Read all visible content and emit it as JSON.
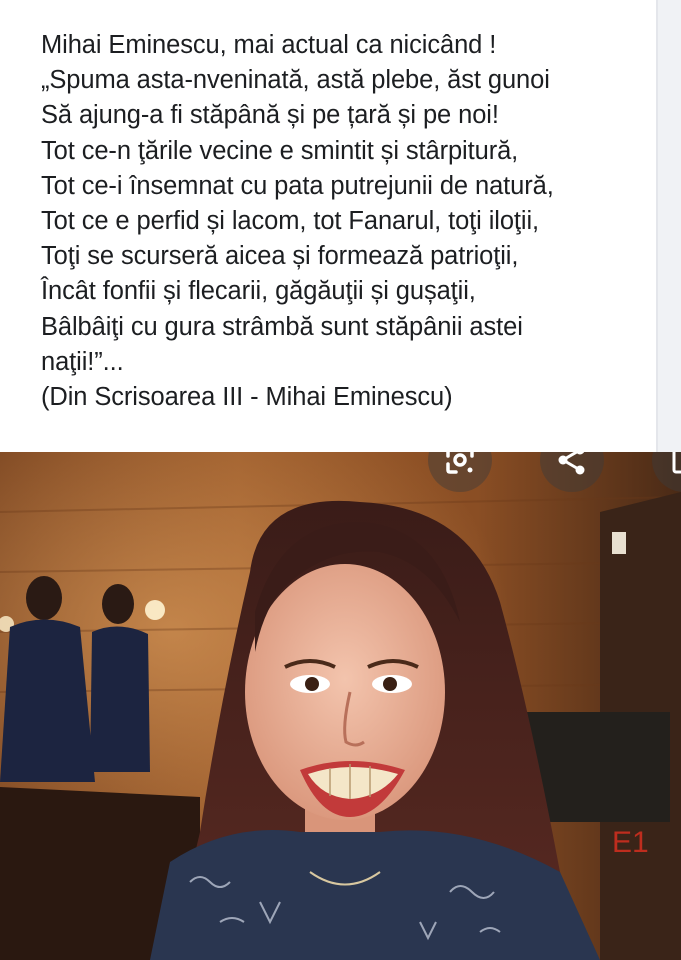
{
  "post": {
    "lines": [
      "Mihai Eminescu, mai actual ca nicicând !",
      "„Spuma asta-nveninată, astă plebe, ăst gunoi",
      "Să ajung-a fi stăpână și pe țară și pe noi!",
      "Tot ce-n ţările vecine e smintit și stârpitură,",
      "Tot ce-i însemnat cu pata putrejunii de natură,",
      "Tot ce e perfid și lacom, tot Fanarul, toţi iloţii,",
      "Toţi se scurseră aicea și formează patrioţii,",
      "Încât fonfii și flecarii, găgăuţii și gușaţii,",
      "Bâlbâiţi cu gura strâmbă sunt stăpânii astei",
      "naţii!”...",
      "(Din Scrisoarea III - Mihai Eminescu)"
    ]
  },
  "photo": {
    "overlay_icons": [
      "google-lens-icon",
      "share-icon",
      "more-icon"
    ]
  }
}
